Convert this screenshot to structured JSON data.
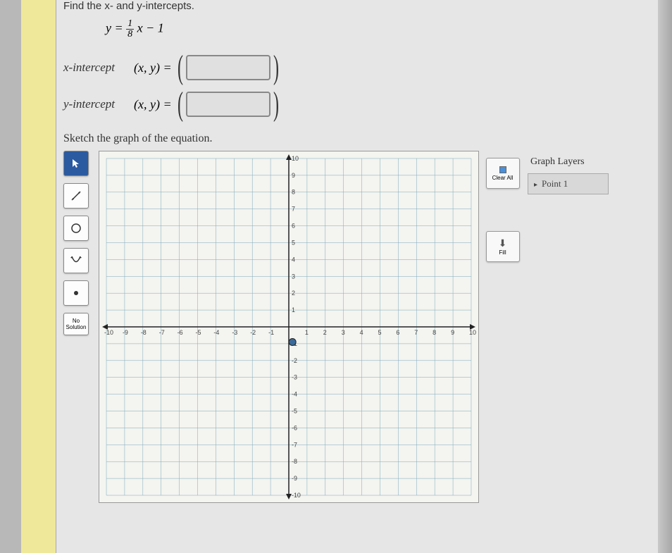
{
  "prompt": "Find the x- and y-intercepts.",
  "equation": {
    "lhs": "y =",
    "frac_num": "1",
    "frac_den": "8",
    "rhs": "x − 1"
  },
  "intercepts": {
    "x_label": "x-intercept",
    "y_label": "y-intercept",
    "eq_prefix": "(x, y) ="
  },
  "sketch_label": "Sketch the graph of the equation.",
  "tools": {
    "nosol_line1": "No",
    "nosol_line2": "Solution"
  },
  "side": {
    "clear": "Clear All",
    "fill": "Fill"
  },
  "layers": {
    "title": "Graph Layers",
    "item1": "Point 1"
  },
  "chart_data": {
    "type": "scatter",
    "title": "",
    "xlabel": "",
    "ylabel": "",
    "xlim": [
      -10,
      10
    ],
    "ylim": [
      -10,
      10
    ],
    "xticks": [
      -10,
      -9,
      -8,
      -7,
      -6,
      -5,
      -4,
      -3,
      -2,
      -1,
      1,
      2,
      3,
      4,
      5,
      6,
      7,
      8,
      9,
      10
    ],
    "yticks": [
      -10,
      -9,
      -8,
      -7,
      -6,
      -5,
      -4,
      -3,
      -2,
      -1,
      1,
      2,
      3,
      4,
      5,
      6,
      7,
      8,
      9,
      10
    ],
    "series": [
      {
        "name": "Point 1",
        "points": [
          [
            0.2,
            -0.9
          ]
        ]
      }
    ],
    "grid": true
  }
}
